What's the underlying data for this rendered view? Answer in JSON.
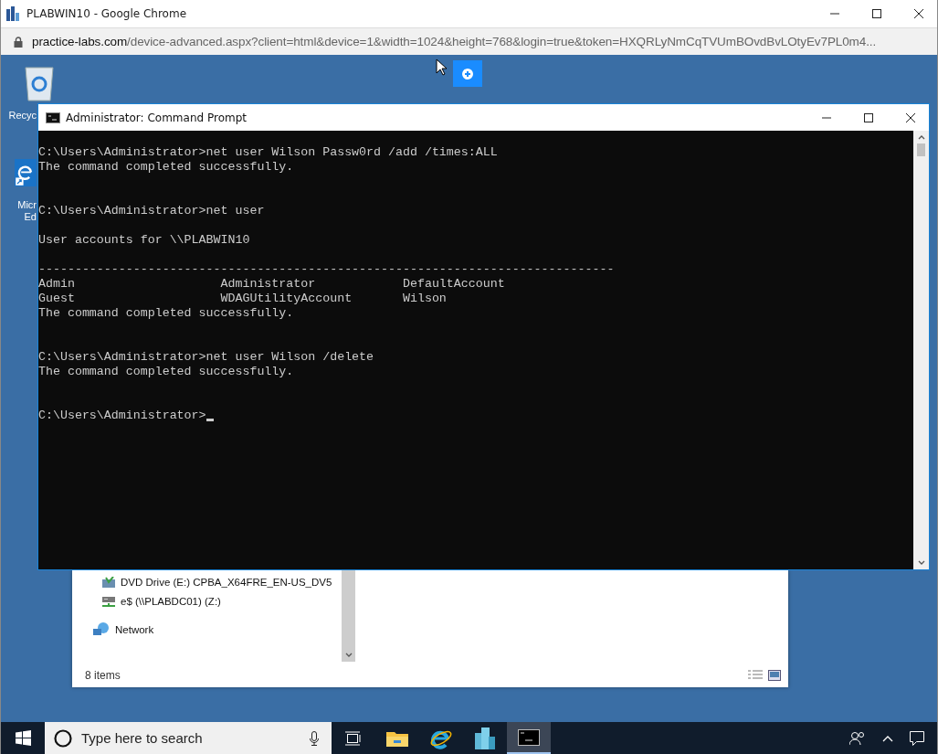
{
  "browser": {
    "title": "PLABWIN10 - Google Chrome",
    "url_host": "practice-labs.com",
    "url_rest": "/device-advanced.aspx?client=html&device=1&width=1024&height=768&login=true&token=HXQRLyNmCqTVUmBOvdBvLOtyEv7PL0m4..."
  },
  "desktop_icons": [
    {
      "kind": "recycle",
      "lines": [
        "Recyc"
      ]
    },
    {
      "kind": "edge",
      "lines": [
        "Micr",
        "Ed"
      ]
    }
  ],
  "explorer": {
    "items": [
      {
        "kind": "dvd",
        "label": "DVD Drive (E:) CPBA_X64FRE_EN-US_DV5"
      },
      {
        "kind": "share",
        "label": "e$ (\\\\PLABDC01) (Z:)"
      },
      {
        "kind": "network",
        "label": "Network"
      }
    ],
    "status": "8 items"
  },
  "cmd": {
    "title": "Administrator: Command Prompt",
    "lines": [
      {
        "kind": "text",
        "text": "C:\\Users\\Administrator>net user Wilson Passw0rd /add /times:ALL"
      },
      {
        "kind": "text",
        "text": "The command completed successfully."
      },
      {
        "kind": "blank"
      },
      {
        "kind": "blank"
      },
      {
        "kind": "text",
        "text": "C:\\Users\\Administrator>net user"
      },
      {
        "kind": "blank"
      },
      {
        "kind": "text",
        "text": "User accounts for \\\\PLABWIN10"
      },
      {
        "kind": "blank"
      },
      {
        "kind": "text",
        "text": "-------------------------------------------------------------------------------"
      },
      {
        "kind": "text",
        "text": "Admin                    Administrator            DefaultAccount"
      },
      {
        "kind": "text",
        "text": "Guest                    WDAGUtilityAccount       Wilson"
      },
      {
        "kind": "text",
        "text": "The command completed successfully."
      },
      {
        "kind": "blank"
      },
      {
        "kind": "blank"
      },
      {
        "kind": "text",
        "text": "C:\\Users\\Administrator>net user Wilson /delete"
      },
      {
        "kind": "text",
        "text": "The command completed successfully."
      },
      {
        "kind": "blank"
      },
      {
        "kind": "blank"
      },
      {
        "kind": "text",
        "text": "C:\\Users\\Administrator>"
      }
    ],
    "cursor": true
  },
  "taskbar": {
    "search_placeholder": "Type here to search",
    "apps": [
      {
        "kind": "taskview",
        "selected": false
      },
      {
        "kind": "folder",
        "selected": false
      },
      {
        "kind": "ie",
        "selected": false
      },
      {
        "kind": "building",
        "selected": false
      },
      {
        "kind": "cmd",
        "selected": true
      }
    ]
  }
}
